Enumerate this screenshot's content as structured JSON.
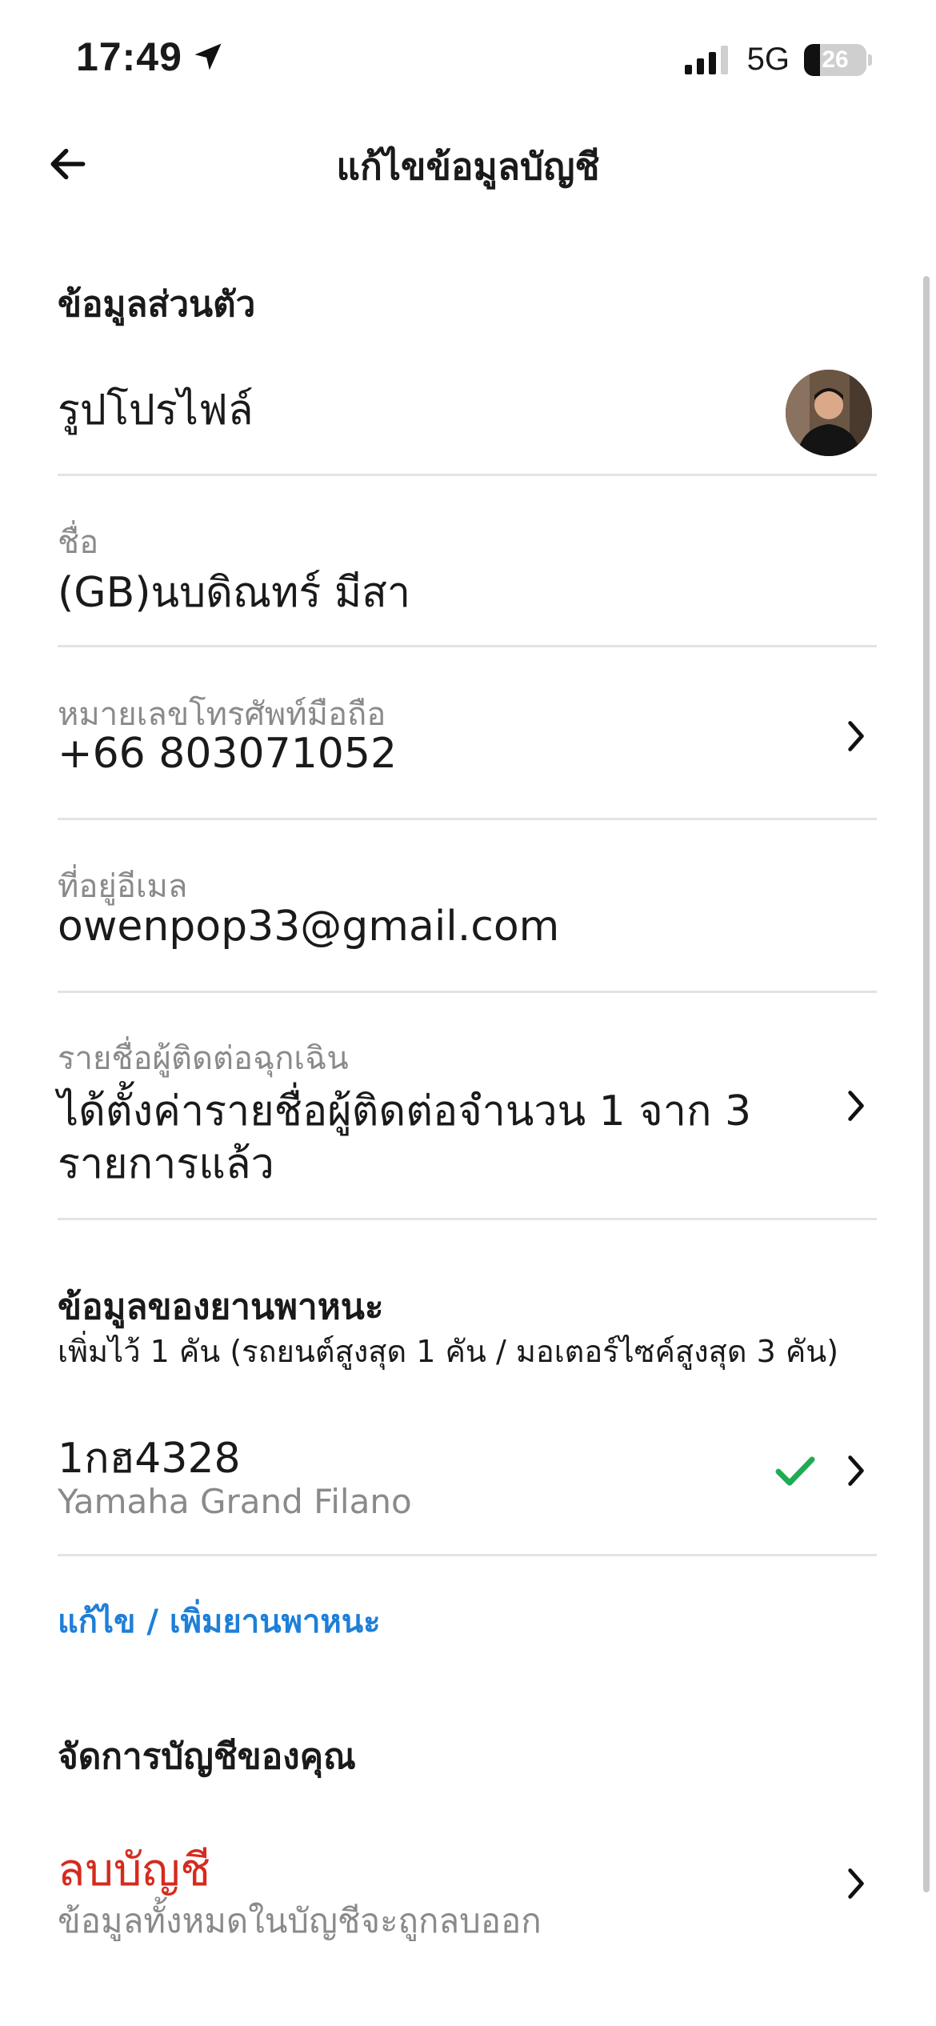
{
  "status_bar": {
    "time": "17:49",
    "network": "5G",
    "battery_level": "26"
  },
  "header": {
    "title": "แก้ไขข้อมูลบัญชี"
  },
  "personal": {
    "heading": "ข้อมูลส่วนตัว",
    "profile_photo_label": "รูปโปรไฟล์",
    "name_label": "ชื่อ",
    "name_value": "(GB)นบดิณทร์ มีสา",
    "phone_label": "หมายเลขโทรศัพท์มือถือ",
    "phone_value": "+66 803071052",
    "email_label": "ที่อยู่อีเมล",
    "email_value": "owenpop33@gmail.com",
    "emergency_label": "รายชื่อผู้ติดต่อฉุกเฉิน",
    "emergency_value_line1": "ได้ตั้งค่ารายชื่อผู้ติดต่อจำนวน 1 จาก 3",
    "emergency_value_line2": "รายการแล้ว"
  },
  "vehicle": {
    "heading": "ข้อมูลของยานพาหนะ",
    "subheading": "เพิ่มไว้ 1 คัน (รถยนต์สูงสุด 1 คัน / มอเตอร์ไซค์สูงสุด 3 คัน)",
    "plate": "1กฮ4328",
    "model": "Yamaha Grand Filano",
    "edit_link": "แก้ไข / เพิ่มยานพาหนะ"
  },
  "account": {
    "heading": "จัดการบัญชีของคุณ",
    "delete_label": "ลบบัญชี",
    "delete_sub": "ข้อมูลทั้งหมดในบัญชีจะถูกลบออก"
  },
  "colors": {
    "link": "#1e7fd8",
    "danger": "#d62a1e",
    "check": "#1fab54",
    "divider": "#e3e3e3"
  },
  "icons": {
    "back": "arrow-left-icon",
    "chevron": "chevron-right-icon",
    "check": "check-icon",
    "location": "location-arrow-icon",
    "signal": "signal-bars-icon",
    "battery": "battery-icon"
  }
}
